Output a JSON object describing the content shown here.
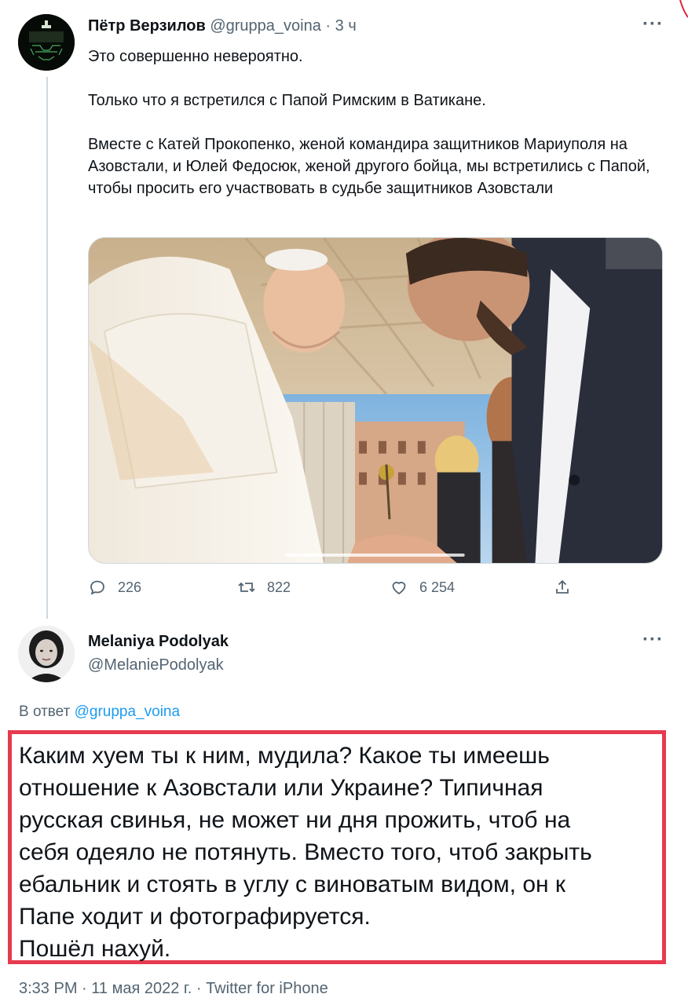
{
  "tweet1": {
    "name": "Пётр Верзилов",
    "handle": "@gruppa_voina",
    "separator": "·",
    "time": "3 ч",
    "paragraphs": [
      "Это совершенно невероятно.",
      "Только что я встретился с Папой Римским в Ватикане.",
      "Вместе с Катей Прокопенко, женой командира защитников Мариуполя на Азовстали, и Юлей Федосюк, женой другого бойца, мы встретились с Папой, чтобы просить его участвовать в судьбе защитников Азовстали"
    ],
    "more_icon": "more-horizontal-icon",
    "photo_icon": "photo-attachment",
    "actions": {
      "replies": "226",
      "retweets": "822",
      "likes": "6 254"
    }
  },
  "tweet2": {
    "name": "Melaniya Podolyak",
    "handle": "@MelaniePodolyak",
    "replying_label": "В ответ",
    "replying_to": "@gruppa_voina",
    "text_lines": [
      "Каким хуем ты к ним, мудила? Какое ты имеешь",
      "отношение к Азовстали или Украине? Типичная",
      "русская свинья, не может ни дня прожить, чтоб на",
      "себя одеяло не потянуть. Вместо того, чтоб закрыть",
      "ебальник и стоять в углу с виноватым видом, он к",
      "Папе ходит и фотографируется.",
      "Пошёл нахуй."
    ],
    "highlight_color": "#e63a4f",
    "footer": "3:33 PM · 11 мая 2022 г. · Twitter for iPhone"
  },
  "colors": {
    "text": "#0f1419",
    "secondary": "#536471",
    "link": "#1d9bf0",
    "divider": "#cfd9de"
  }
}
